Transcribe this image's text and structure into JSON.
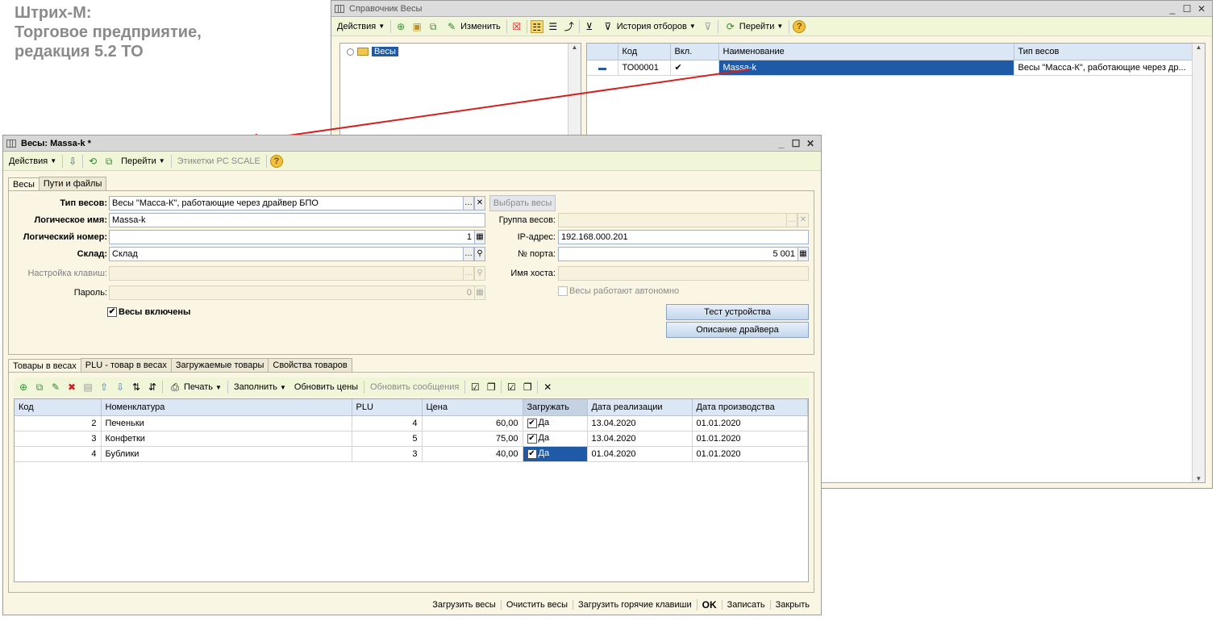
{
  "brand": {
    "line1": "Штрих-М:",
    "line2": "Торговое предприятие,",
    "line3": "редакция 5.2 ТО"
  },
  "back_window": {
    "title": "Справочник Весы",
    "toolbar": {
      "actions": "Действия",
      "edit": "Изменить",
      "history": "История отборов",
      "goto": "Перейти"
    },
    "tree": {
      "root": "Весы"
    },
    "table": {
      "headers": [
        "Код",
        "Вкл.",
        "Наименование",
        "Тип весов"
      ],
      "rows": [
        {
          "code": "ТО00001",
          "enabled": "✔",
          "name": "Massa-k",
          "type": "Весы \"Масса-К\", работающие через др..."
        }
      ]
    }
  },
  "form": {
    "title": "Весы: Massa-k *",
    "toolbar": {
      "actions": "Действия",
      "goto": "Перейти",
      "labels": "Этикетки PC SCALE"
    },
    "tabs": [
      "Весы",
      "Пути и файлы"
    ],
    "fields": {
      "type_label": "Тип весов:",
      "type_value": "Весы \"Масса-К\", работающие через драйвер БПО",
      "logical_name_label": "Логическое имя:",
      "logical_name_value": "Massa-k",
      "logical_number_label": "Логический номер:",
      "logical_number_value": "1",
      "warehouse_label": "Склад:",
      "warehouse_value": "Склад",
      "keys_label": "Настройка клавиш:",
      "keys_value": "",
      "password_label": "Пароль:",
      "password_value": "0",
      "enabled_label": "Весы включены",
      "select_scales": "Выбрать весы",
      "group_label": "Группа весов:",
      "group_value": "",
      "ip_label": "IP-адрес:",
      "ip_value": "192.168.000.201",
      "port_label": "№ порта:",
      "port_value": "5 001",
      "host_label": "Имя хоста:",
      "host_value": "",
      "autonomous_label": "Весы работают автономно",
      "test_button": "Тест устройства",
      "driver_button": "Описание драйвера"
    },
    "lower_tabs": [
      "Товары в весах",
      "PLU - товар в весах",
      "Загружаемые товары",
      "Свойства товаров"
    ],
    "lower_toolbar": {
      "print": "Печать",
      "fill": "Заполнить",
      "update_prices": "Обновить цены",
      "update_messages": "Обновить сообщения"
    },
    "goods_table": {
      "headers": [
        "Код",
        "Номенклатура",
        "PLU",
        "Цена",
        "Загружать",
        "Дата реализации",
        "Дата производства"
      ],
      "rows": [
        {
          "code": "2",
          "name": "Печеньки",
          "plu": "4",
          "price": "60,00",
          "load": "Да",
          "sale_date": "13.04.2020",
          "prod_date": "01.01.2020"
        },
        {
          "code": "3",
          "name": "Конфетки",
          "plu": "5",
          "price": "75,00",
          "load": "Да",
          "sale_date": "13.04.2020",
          "prod_date": "01.01.2020"
        },
        {
          "code": "4",
          "name": "Бублики",
          "plu": "3",
          "price": "40,00",
          "load": "Да",
          "sale_date": "01.04.2020",
          "prod_date": "01.01.2020"
        }
      ]
    },
    "footer": {
      "load_scales": "Загрузить весы",
      "clear_scales": "Очистить весы",
      "load_hotkeys": "Загрузить горячие клавиши",
      "ok": "OK",
      "save": "Записать",
      "close": "Закрыть"
    }
  },
  "colors": {
    "accent": "#1f5aa6",
    "toolbar_bg": "#f1f6d9",
    "form_bg": "#fbf6e4",
    "arrow": "#d42020"
  }
}
